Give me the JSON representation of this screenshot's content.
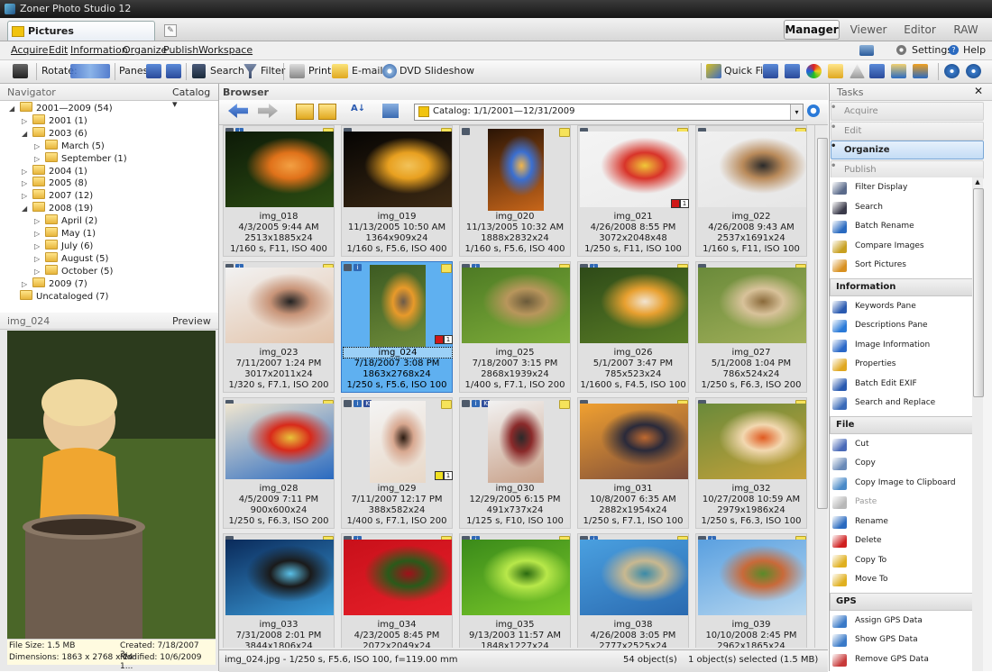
{
  "window": {
    "title": "Zoner Photo Studio 12"
  },
  "tabs": {
    "document_tab": "Pictures",
    "modes": [
      "Manager",
      "Viewer",
      "Editor",
      "RAW"
    ],
    "active_mode": "Manager"
  },
  "menu": {
    "items": [
      "Acquire",
      "Edit",
      "Information",
      "Organize",
      "Publish",
      "Workspace"
    ],
    "settings": "Settings",
    "help": "Help"
  },
  "toolbar": {
    "rotate": "Rotate:",
    "panes": "Panes:",
    "search": "Search",
    "filter": "Filter",
    "print": "Print",
    "email": "E-mail",
    "dvd": "DVD Slideshow",
    "quickfix": "Quick Fix"
  },
  "navigator": {
    "title": "Navigator",
    "catalog": "Catalog",
    "tree": [
      {
        "label": "2001—2009 (54)",
        "level": 0,
        "expanded": true
      },
      {
        "label": "2001 (1)",
        "level": 1,
        "expanded": false
      },
      {
        "label": "2003 (6)",
        "level": 1,
        "expanded": true
      },
      {
        "label": "March (5)",
        "level": 2,
        "expanded": false
      },
      {
        "label": "September (1)",
        "level": 2,
        "expanded": false
      },
      {
        "label": "2004 (1)",
        "level": 1,
        "expanded": false
      },
      {
        "label": "2005 (8)",
        "level": 1,
        "expanded": false
      },
      {
        "label": "2007 (12)",
        "level": 1,
        "expanded": false
      },
      {
        "label": "2008 (19)",
        "level": 1,
        "expanded": true
      },
      {
        "label": "April (2)",
        "level": 2,
        "expanded": false
      },
      {
        "label": "May (1)",
        "level": 2,
        "expanded": false
      },
      {
        "label": "July (6)",
        "level": 2,
        "expanded": false
      },
      {
        "label": "August (5)",
        "level": 2,
        "expanded": false
      },
      {
        "label": "October (5)",
        "level": 2,
        "expanded": false
      },
      {
        "label": "2009 (7)",
        "level": 1,
        "expanded": false
      },
      {
        "label": "Uncataloged (7)",
        "level": 0,
        "expanded": false
      }
    ]
  },
  "preview": {
    "filename": "img_024",
    "mode": "Preview",
    "file_size": "File Size: 1.5 MB",
    "created": "Created: 7/18/2007 3:...",
    "dimensions": "Dimensions: 1863 x 2768 x 24",
    "modified": "Modified: 10/6/2009 1..."
  },
  "browser": {
    "title": "Browser",
    "path": "Catalog: 1/1/2001—12/31/2009",
    "thumbnails": [
      {
        "name": "img_018",
        "date": "4/3/2005 9:44 AM",
        "dims": "2513x1885x24",
        "exif": "1/160 s, F11, ISO 400",
        "colors": [
          "#0d1a08",
          "#2c4d12",
          "#e0721a",
          "#f3a043"
        ],
        "orientation": "landscape",
        "badges": [
          "cam",
          "info"
        ]
      },
      {
        "name": "img_019",
        "date": "11/13/2005 10:50 AM",
        "dims": "1364x909x24",
        "exif": "1/160 s, F5.6, ISO 400",
        "colors": [
          "#050403",
          "#3d2a14",
          "#e8a020",
          "#f2c35a"
        ],
        "orientation": "landscape",
        "badges": [
          "cam"
        ]
      },
      {
        "name": "img_020",
        "date": "11/13/2005 10:32 AM",
        "dims": "1888x2832x24",
        "exif": "1/160 s, F5.6, ISO 400",
        "colors": [
          "#2a1405",
          "#c8661a",
          "#3b6fd0",
          "#f2b64a"
        ],
        "orientation": "portrait",
        "badges": [
          "cam"
        ]
      },
      {
        "name": "img_021",
        "date": "4/26/2008 8:55 PM",
        "dims": "3072x2048x48",
        "exif": "1/250 s, F11, ISO 100",
        "colors": [
          "#f4f4f4",
          "#ececec",
          "#d8342a",
          "#f0c838"
        ],
        "orientation": "landscape",
        "badges": [
          "cam"
        ],
        "label": "#d01818",
        "rating": "1"
      },
      {
        "name": "img_022",
        "date": "4/26/2008 9:43 AM",
        "dims": "2537x1691x24",
        "exif": "1/160 s, F11, ISO 100",
        "colors": [
          "#f0f0f0",
          "#e6e6e6",
          "#b98a5a",
          "#2a2a2a"
        ],
        "orientation": "landscape",
        "badges": [
          "cam"
        ]
      },
      {
        "name": "img_023",
        "date": "7/11/2007 1:24 PM",
        "dims": "3017x2011x24",
        "exif": "1/320 s, F7.1, ISO 200",
        "colors": [
          "#f2f2f2",
          "#e2c2a8",
          "#c89478",
          "#222"
        ],
        "orientation": "landscape",
        "badges": [
          "cam",
          "info"
        ]
      },
      {
        "name": "img_024",
        "date": "7/18/2007 3:08 PM",
        "dims": "1863x2768x24",
        "exif": "1/250 s, F5.6, ISO 100",
        "colors": [
          "#3c5a22",
          "#6e8c3a",
          "#e89a2a",
          "#6b5a4a"
        ],
        "orientation": "portrait",
        "badges": [
          "cam",
          "info"
        ],
        "label": "#d01818",
        "rating": "1",
        "selected": true
      },
      {
        "name": "img_025",
        "date": "7/18/2007 3:15 PM",
        "dims": "2868x1939x24",
        "exif": "1/400 s, F7.1, ISO 200",
        "colors": [
          "#4d7a24",
          "#7fae3a",
          "#b8965c",
          "#6a5a3a"
        ],
        "orientation": "landscape",
        "badges": [
          "cam",
          "info"
        ]
      },
      {
        "name": "img_026",
        "date": "5/1/2007 3:47 PM",
        "dims": "785x523x24",
        "exif": "1/1600 s, F4.5, ISO 100",
        "colors": [
          "#2e4a18",
          "#5a7e26",
          "#e8a030",
          "#f2e4d0"
        ],
        "orientation": "landscape",
        "badges": [
          "cam",
          "info"
        ]
      },
      {
        "name": "img_027",
        "date": "5/1/2008 1:04 PM",
        "dims": "786x524x24",
        "exif": "1/250 s, F6.3, ISO 200",
        "colors": [
          "#6a8a3a",
          "#a2b05a",
          "#d8c29a",
          "#8a6a3a"
        ],
        "orientation": "landscape",
        "badges": [
          "cam"
        ]
      },
      {
        "name": "img_028",
        "date": "4/5/2009 7:11 PM",
        "dims": "900x600x24",
        "exif": "1/250 s, F6.3, ISO 200",
        "colors": [
          "#f0e6d0",
          "#2a6ac0",
          "#d82a1a",
          "#e8c23a"
        ],
        "orientation": "landscape",
        "badges": [
          "cam"
        ]
      },
      {
        "name": "img_029",
        "date": "7/11/2007 12:17 PM",
        "dims": "388x582x24",
        "exif": "1/400 s, F7.1, ISO 200",
        "colors": [
          "#f4f4f4",
          "#e8d8c8",
          "#d8a890",
          "#2a1a10"
        ],
        "orientation": "portrait",
        "badges": [
          "cam",
          "info",
          "k"
        ],
        "label": "#f0e020",
        "rating": "1"
      },
      {
        "name": "img_030",
        "date": "12/29/2005 6:15 PM",
        "dims": "491x737x24",
        "exif": "1/125 s, F10, ISO 100",
        "colors": [
          "#f2f2f2",
          "#c8a088",
          "#8a2a2a",
          "#2a2a2a"
        ],
        "orientation": "portrait",
        "badges": [
          "cam",
          "info",
          "k"
        ]
      },
      {
        "name": "img_031",
        "date": "10/8/2007 6:35 AM",
        "dims": "2882x1954x24",
        "exif": "1/250 s, F7.1, ISO 100",
        "colors": [
          "#f0a030",
          "#7a4a3a",
          "#2a2a3a",
          "#c06a30"
        ],
        "orientation": "landscape",
        "badges": [
          "cam"
        ]
      },
      {
        "name": "img_032",
        "date": "10/27/2008 10:59 AM",
        "dims": "2979x1986x24",
        "exif": "1/250 s, F6.3, ISO 100",
        "colors": [
          "#6a8a3a",
          "#c8a23a",
          "#f2d8b0",
          "#e05a20"
        ],
        "orientation": "landscape",
        "badges": [
          "cam"
        ]
      },
      {
        "name": "img_033",
        "date": "7/31/2008 2:01 PM",
        "dims": "3844x1806x24",
        "exif": "1/250 s, F7.1, ISO 200",
        "colors": [
          "#0a2a5a",
          "#3a9ad8",
          "#1a1a1a",
          "#5ac0e8"
        ],
        "orientation": "landscape",
        "badges": [
          "cam"
        ]
      },
      {
        "name": "img_034",
        "date": "4/23/2005 8:45 PM",
        "dims": "2072x2049x24",
        "exif": "1/250 s, F7.1, ISO 200",
        "colors": [
          "#c8101a",
          "#e8202a",
          "#2a5a1a",
          "#a0101a"
        ],
        "orientation": "landscape",
        "badges": [
          "cam",
          "info"
        ]
      },
      {
        "name": "img_035",
        "date": "9/13/2003 11:57 AM",
        "dims": "1848x1227x24",
        "exif": "1/250 s, F7.1, ISO 200",
        "colors": [
          "#3a8a1a",
          "#7ac82a",
          "#b8e84a",
          "#2a6a10"
        ],
        "orientation": "landscape",
        "badges": [
          "cam",
          "info"
        ]
      },
      {
        "name": "img_038",
        "date": "4/26/2008 3:05 PM",
        "dims": "2777x2525x24",
        "exif": "1/250 s, F6.3, ISO 200",
        "colors": [
          "#4aa0e0",
          "#2a6ab0",
          "#c8b890",
          "#3a8aa8"
        ],
        "orientation": "landscape",
        "badges": [
          "cam",
          "info"
        ]
      },
      {
        "name": "img_039",
        "date": "10/10/2008 2:45 PM",
        "dims": "2962x1865x24",
        "exif": "1/250 s, F6.3, ISO 200",
        "colors": [
          "#5aa0e0",
          "#b8d8f0",
          "#c86a3a",
          "#5a8a2a"
        ],
        "orientation": "landscape",
        "badges": [
          "cam",
          "info"
        ]
      }
    ]
  },
  "status": {
    "selected_info": "img_024.jpg - 1/250 s, F5.6, ISO 100, f=119.00 mm",
    "count": "54 object(s)",
    "selection": "1 object(s) selected (1.5 MB)"
  },
  "tasks": {
    "title": "Tasks",
    "categories": [
      "Acquire",
      "Edit",
      "Organize",
      "Publish"
    ],
    "active_category": "Organize",
    "sections": [
      {
        "header": "",
        "items": [
          {
            "label": "Filter Display",
            "icon": "funnel-icon",
            "color": "#5a6a8a"
          },
          {
            "label": "Search",
            "icon": "binoculars-icon",
            "color": "#3a3a4a"
          },
          {
            "label": "Batch Rename",
            "icon": "rename-icon",
            "color": "#2a6ac0"
          },
          {
            "label": "Compare Images",
            "icon": "compare-icon",
            "color": "#c8a020"
          },
          {
            "label": "Sort Pictures",
            "icon": "sort-icon",
            "color": "#d89020"
          }
        ]
      },
      {
        "header": "Information",
        "items": [
          {
            "label": "Keywords Pane",
            "icon": "keywords-icon",
            "color": "#2a5ab0"
          },
          {
            "label": "Descriptions Pane",
            "icon": "descriptions-icon",
            "color": "#2a7ad8"
          },
          {
            "label": "Image Information",
            "icon": "info-icon",
            "color": "#2a68c8"
          },
          {
            "label": "Properties",
            "icon": "properties-icon",
            "color": "#e0a820"
          },
          {
            "label": "Batch Edit EXIF",
            "icon": "exif-icon",
            "color": "#2a5ab0"
          },
          {
            "label": "Search and Replace",
            "icon": "search-replace-icon",
            "color": "#3a6ab8"
          }
        ]
      },
      {
        "header": "File",
        "items": [
          {
            "label": "Cut",
            "icon": "scissors-icon",
            "color": "#4a6ab8"
          },
          {
            "label": "Copy",
            "icon": "copy-icon",
            "color": "#6a8ab8"
          },
          {
            "label": "Copy Image to Clipboard",
            "icon": "clipboard-icon",
            "color": "#4a8ac8"
          },
          {
            "label": "Paste",
            "icon": "paste-icon",
            "color": "#b8b8b8",
            "disabled": true
          },
          {
            "label": "Rename",
            "icon": "rename-icon",
            "color": "#2a6ac0"
          },
          {
            "label": "Delete",
            "icon": "delete-icon",
            "color": "#d02020"
          },
          {
            "label": "Copy To",
            "icon": "copy-to-icon",
            "color": "#e0b020"
          },
          {
            "label": "Move To",
            "icon": "move-to-icon",
            "color": "#e0b020"
          }
        ]
      },
      {
        "header": "GPS",
        "items": [
          {
            "label": "Assign GPS Data",
            "icon": "gps-assign-icon",
            "color": "#3a7ac8"
          },
          {
            "label": "Show GPS Data",
            "icon": "gps-show-icon",
            "color": "#3a7ac8"
          },
          {
            "label": "Remove GPS Data",
            "icon": "gps-remove-icon",
            "color": "#c83a3a"
          }
        ]
      }
    ]
  }
}
